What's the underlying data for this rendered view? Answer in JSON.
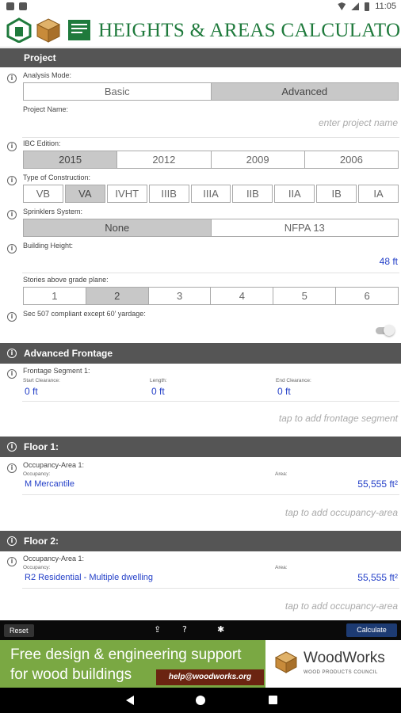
{
  "app": {
    "title": "HEIGHTS & AREAS CALCULATOR"
  },
  "statusbar": {
    "time": "11:05"
  },
  "project": {
    "header": "Project",
    "analysis_mode": {
      "label": "Analysis Mode:",
      "options": [
        "Basic",
        "Advanced"
      ],
      "selected": "Advanced"
    },
    "project_name": {
      "label": "Project Name:",
      "placeholder": "enter project name"
    },
    "ibc_edition": {
      "label": "IBC Edition:",
      "options": [
        "2015",
        "2012",
        "2009",
        "2006"
      ],
      "selected": "2015"
    },
    "construction_type": {
      "label": "Type of Construction:",
      "options": [
        "VB",
        "VA",
        "IVHT",
        "IIIB",
        "IIIA",
        "IIB",
        "IIA",
        "IB",
        "IA"
      ],
      "selected": "VA"
    },
    "sprinklers": {
      "label": "Sprinklers System:",
      "options": [
        "None",
        "NFPA 13"
      ],
      "selected": "None"
    },
    "building_height": {
      "label": "Building Height:",
      "value": "48 ft"
    },
    "stories": {
      "label": "Stories above grade plane:",
      "options": [
        "1",
        "2",
        "3",
        "4",
        "5",
        "6"
      ],
      "selected": "2"
    },
    "sec507": {
      "label": "Sec 507 compliant except 60' yardage:",
      "enabled": false
    }
  },
  "frontage": {
    "header": "Advanced Frontage",
    "segment_label": "Frontage Segment 1:",
    "start_label": "Start Clearance:",
    "start_value": "0 ft",
    "length_label": "Length:",
    "length_value": "0 ft",
    "end_label": "End Clearance:",
    "end_value": "0 ft",
    "add_hint": "tap to add frontage segment"
  },
  "floors": [
    {
      "header": "Floor 1:",
      "area_label": "Occupancy-Area 1:",
      "occupancy_label": "Occupancy:",
      "occupancy_value": "M Mercantile",
      "area_sub": "Area:",
      "area_value": "55,555 ft²",
      "add_hint": "tap to add occupancy-area"
    },
    {
      "header": "Floor 2:",
      "area_label": "Occupancy-Area 1:",
      "occupancy_label": "Occupancy:",
      "occupancy_value": "R2 Residential - Multiple dwelling",
      "area_sub": "Area:",
      "area_value": "55,555 ft²",
      "add_hint": "tap to add occupancy-area"
    }
  ],
  "toolbar": {
    "reset": "Reset",
    "calculate": "Calculate"
  },
  "banner": {
    "line1": "Free design & engineering support",
    "line2": "for wood buildings",
    "email": "help@woodworks.org",
    "brand": "WoodWorks",
    "tagline": "WOOD PRODUCTS COUNCIL"
  },
  "colors": {
    "accent_green": "#1f7a3c",
    "value_blue": "#2440c8",
    "section_gray": "#555555",
    "banner_green": "#7aa843",
    "calc_blue": "#1d3b73"
  },
  "icons": [
    "info-icon",
    "upload-icon",
    "help-icon",
    "settings-icon",
    "back-icon",
    "home-icon",
    "recent-apps-icon"
  ]
}
